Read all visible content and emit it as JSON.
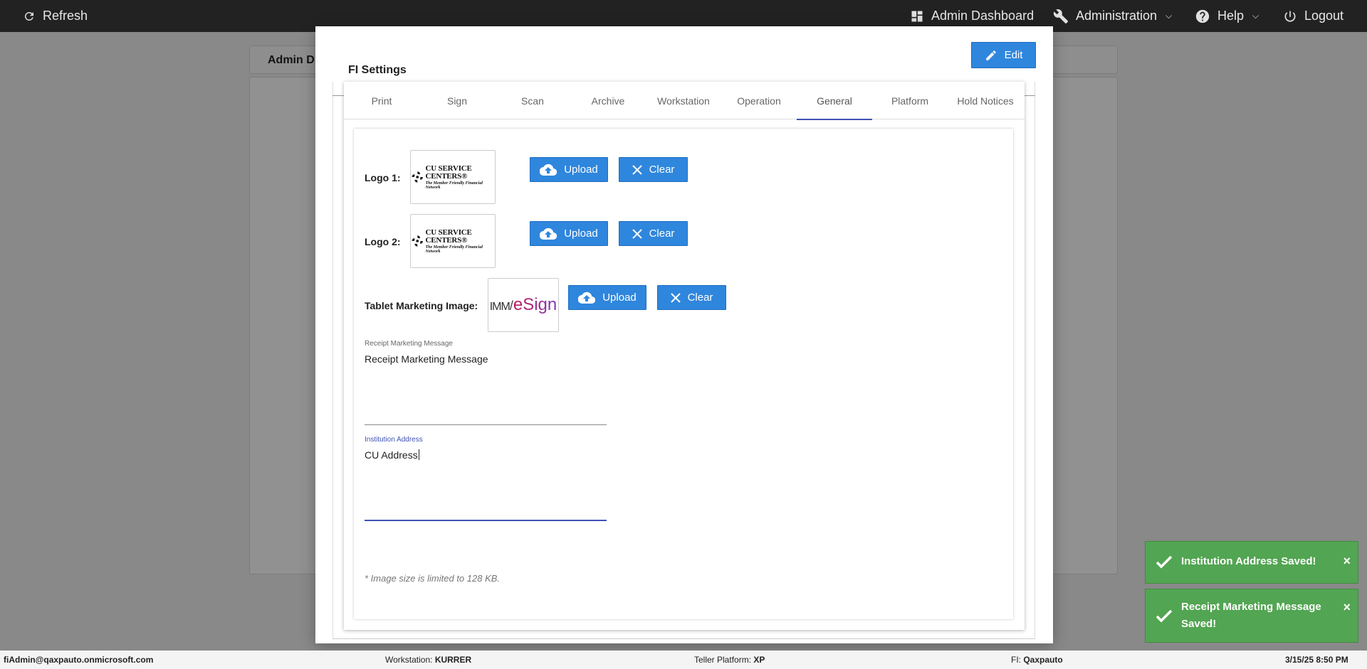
{
  "topbar": {
    "refresh_label": "Refresh",
    "admin_dashboard_label": "Admin Dashboard",
    "administration_label": "Administration",
    "help_label": "Help",
    "logout_label": "Logout"
  },
  "background": {
    "tab_label": "Admin D"
  },
  "modal": {
    "title": "FI Settings",
    "edit_label": "Edit",
    "tabs": [
      "Print",
      "Sign",
      "Scan",
      "Archive",
      "Workstation",
      "Operation",
      "General",
      "Platform",
      "Hold Notices"
    ],
    "active_tab": "General",
    "rows": {
      "logo1_label": "Logo 1:",
      "logo2_label": "Logo 2:",
      "tablet_label": "Tablet Marketing Image:",
      "upload_label": "Upload",
      "clear_label": "Clear"
    },
    "logo_cu": {
      "main": "CU SERVICE CENTERS®",
      "sub": "The Member Friendly Financial Network"
    },
    "logo_esign": {
      "prefix": "IMM",
      "brand": "eSign"
    },
    "receipt_field": {
      "label": "Receipt Marketing Message",
      "value": "Receipt Marketing Message"
    },
    "address_field": {
      "label": "Institution Address",
      "value": "CU Address"
    },
    "note": "* Image size is limited to 128 KB."
  },
  "toasts": [
    {
      "message": "Institution Address Saved!"
    },
    {
      "message_line1": "Receipt Marketing Message",
      "message_line2": "Saved!"
    }
  ],
  "statusbar": {
    "user": "fiAdmin@qaxpauto.onmicrosoft.com",
    "workstation_label": "Workstation:",
    "workstation_value": "KURRER",
    "platform_label": "Teller Platform:",
    "platform_value": "XP",
    "fi_label": "FI:",
    "fi_value": "Qaxpauto",
    "datetime": "3/15/25 8:50 PM"
  },
  "colors": {
    "primary_button": "#2f86dd",
    "active_tab": "#3f51b5",
    "toast_success": "#52a552",
    "topbar": "#222222"
  }
}
